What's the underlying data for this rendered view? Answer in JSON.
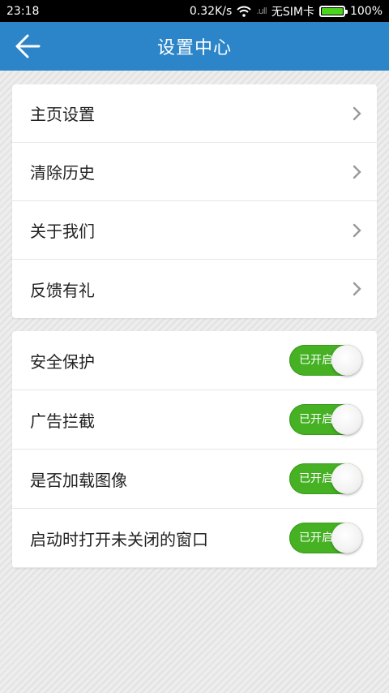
{
  "status_bar": {
    "time": "23:18",
    "speed": "0.32K/s",
    "carrier": "无SIM卡",
    "battery": "100%",
    "battery_level": 1.0,
    "signal_glyph": ".ull"
  },
  "header": {
    "title": "设置中心",
    "back_icon": "arrow-left-icon",
    "color": "#2b85c8"
  },
  "menu": {
    "items": [
      {
        "label": "主页设置"
      },
      {
        "label": "清除历史"
      },
      {
        "label": "关于我们"
      },
      {
        "label": "反馈有礼"
      }
    ]
  },
  "settings": {
    "toggle_on_text": "已开启",
    "toggle_color": "#45b123",
    "items": [
      {
        "label": "安全保护",
        "enabled": true
      },
      {
        "label": "广告拦截",
        "enabled": true
      },
      {
        "label": "是否加载图像",
        "enabled": true
      },
      {
        "label": "启动时打开未关闭的窗口",
        "enabled": true
      }
    ]
  }
}
